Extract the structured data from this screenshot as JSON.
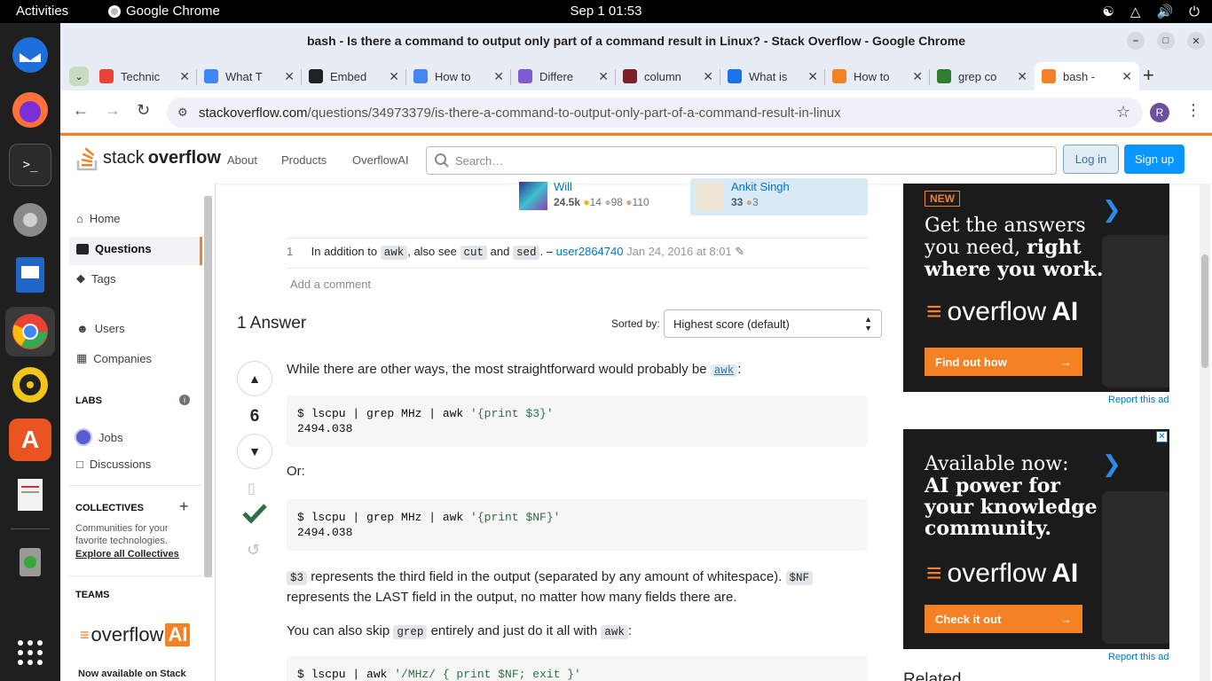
{
  "os": {
    "activities": "Activities",
    "app_name": "Google Chrome",
    "clock": "Sep 1  01:53"
  },
  "window": {
    "title": "bash - Is there a command to output only part of a command result in Linux? - Stack Overflow - Google Chrome"
  },
  "tabs": [
    {
      "label": "Technic",
      "icon": "gmail-icon",
      "color": "#ea4335"
    },
    {
      "label": "What T",
      "icon": "docs-icon",
      "color": "#4285f4"
    },
    {
      "label": "Embed",
      "icon": "notion-icon",
      "color": "#222222"
    },
    {
      "label": "How to",
      "icon": "google-icon",
      "color": "#4285f4"
    },
    {
      "label": "Differe",
      "icon": "flask-icon",
      "color": "#7b5cd6"
    },
    {
      "label": "column",
      "icon": "c-icon",
      "color": "#7a1f2b"
    },
    {
      "label": "What is",
      "icon": "edge-icon",
      "color": "#1a73e8"
    },
    {
      "label": "How to",
      "icon": "stackoverflow-icon",
      "color": "#f48225"
    },
    {
      "label": "grep co",
      "icon": "link-icon",
      "color": "#2f7d32"
    },
    {
      "label": "bash -",
      "icon": "stackoverflow-icon",
      "color": "#f48225"
    }
  ],
  "address": {
    "host": "stackoverflow.com",
    "path": "/questions/34973379/is-there-a-command-to-output-only-part-of-a-command-result-in-linux"
  },
  "profile_initial": "R",
  "so": {
    "logo_text_1": "stack",
    "logo_text_2": "overflow",
    "nav": [
      "About",
      "Products",
      "OverflowAI"
    ],
    "search_placeholder": "Search…",
    "login": "Log in",
    "signup": "Sign up"
  },
  "leftnav": {
    "home": "Home",
    "questions": "Questions",
    "tags": "Tags",
    "users": "Users",
    "companies": "Companies",
    "labs": "LABS",
    "jobs": "Jobs",
    "discussions": "Discussions",
    "collectives": "COLLECTIVES",
    "collectives_desc": "Communities for your favorite technologies.",
    "explore": "Explore all Collectives",
    "teams": "TEAMS",
    "teams_logo_1": "overflow",
    "teams_logo_2": "AI",
    "teams_note": "Now available on Stack"
  },
  "question_users": {
    "editor": {
      "name": "Will",
      "rep": "24.5k",
      "gold": "14",
      "silver": "98",
      "bronze": "110"
    },
    "asker": {
      "name": "Ankit Singh",
      "rep": "33",
      "bronze": "3"
    }
  },
  "comment": {
    "score": "1",
    "text_1": "In addition to",
    "code_1": "awk",
    "text_2": ", also see",
    "code_2": "cut",
    "text_3": "and",
    "code_3": "sed",
    "text_4": ". –",
    "user": "user2864740",
    "date": "Jan 24, 2016 at 8:01",
    "add": "Add a comment"
  },
  "answers": {
    "heading": "1 Answer",
    "sorted_by": "Sorted by:",
    "sort_value": "Highest score (default)",
    "vote": "6"
  },
  "answer_body": {
    "p1": "While there are other ways, the most straightforward would probably be",
    "p1_tag": "awk",
    "p1_end": ":",
    "code1_cmd": "$ lscpu | grep MHz | awk ",
    "code1_str": "'{print $3}'",
    "code1_out": "2494.038",
    "or": "Or:",
    "code2_cmd": "$ lscpu | grep MHz | awk ",
    "code2_str": "'{print $NF}'",
    "code2_out": "2494.038",
    "p3_code1": "$3",
    "p3_text1": "represents the third field in the output (separated by any amount of whitespace).",
    "p3_code2": "$NF",
    "p3_text2": "represents the LAST field in the output, no matter how many fields there are.",
    "p4_text1": "You can also skip",
    "p4_code1": "grep",
    "p4_text2": "entirely and just do it all with",
    "p4_code2": "awk",
    "p4_end": ":",
    "code3_cmd": "$ lscpu | awk ",
    "code3_str": "'/MHz/ { print $NF; exit }'"
  },
  "ads": [
    {
      "badge": "NEW",
      "line1": "Get the answers",
      "line2a": "you need, ",
      "line2b": "right",
      "line3": "where you work.",
      "brand_1": "overflow",
      "brand_2": "AI",
      "cta": "Find out how",
      "report": "Report this ad"
    },
    {
      "line1": "Available now:",
      "line2": "AI power for",
      "line3": "your knowledge",
      "line4": "community.",
      "brand_1": "overflow",
      "brand_2": "AI",
      "cta": "Check it out",
      "report": "Report this ad"
    }
  ],
  "related_heading": "Related",
  "colors": {
    "accent": "#f48225",
    "link": "#0074cc",
    "accepted": "#2f6f44"
  }
}
